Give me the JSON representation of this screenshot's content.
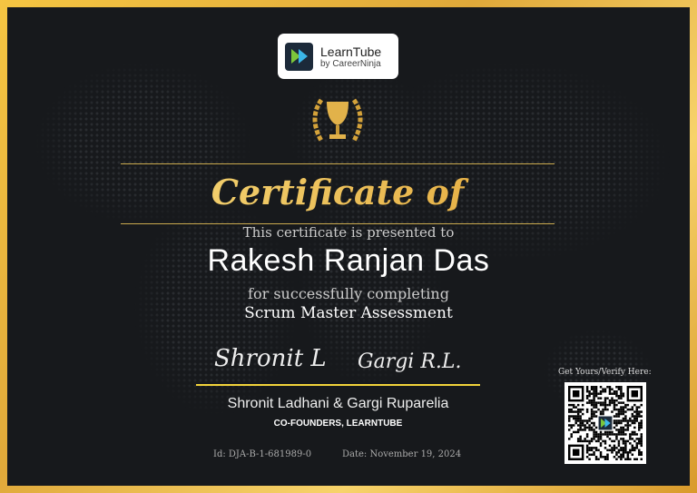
{
  "logo": {
    "name": "LearnTube",
    "sub": "by CareerNinja"
  },
  "title": "Certificate of Completion",
  "presented": "This certificate is presented to",
  "recipient": "Rakesh Ranjan Das",
  "for_text": "for successfully completing",
  "course": "Scrum Master Assessment",
  "signatures": [
    "Shronit L",
    "Gargi R.L."
  ],
  "signers": "Shronit Ladhani & Gargi Ruparelia",
  "signer_role": "CO-FOUNDERS, LEARNTUBE",
  "id": "Id: DJA-B-1-681989-0",
  "date": "Date: November 19, 2024",
  "verify": "Get Yours/Verify Here:",
  "colors": {
    "gold": "#f0c860",
    "bg": "#17191c",
    "line": "#f2d33a"
  }
}
